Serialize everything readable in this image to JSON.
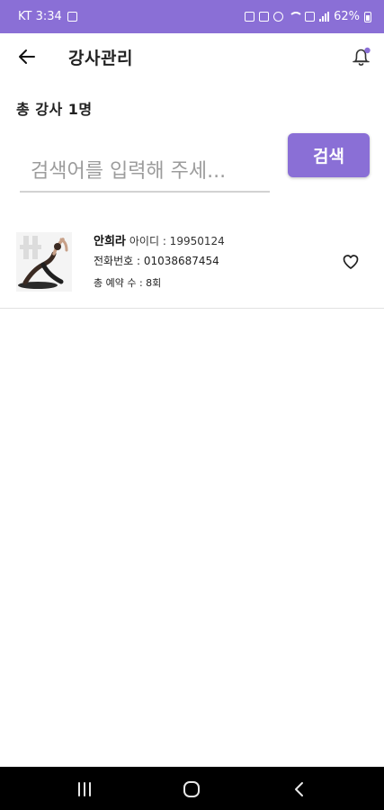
{
  "status_bar": {
    "carrier_time": "KT 3:34",
    "battery": "62%"
  },
  "app_bar": {
    "title": "강사관리"
  },
  "summary": {
    "count_text": "총 강사 1명"
  },
  "search": {
    "placeholder": "검색어를 입력해 주세...",
    "value": "",
    "button_label": "검색"
  },
  "instructors": [
    {
      "name": "안희라",
      "id": "아이디 : 19950124",
      "phone": "전화번호 : 01038687454",
      "reservations": "총 예약 수 : 8회",
      "favorite": false
    }
  ],
  "colors": {
    "accent": "#8a6fd6",
    "status_bar": "#8a6fd6",
    "nav_bar": "#000000"
  },
  "icons": {
    "back": "arrow-left-icon",
    "notification": "bell-icon",
    "favorite": "heart-outline-icon",
    "nav_recents": "recents-icon",
    "nav_home": "home-icon",
    "nav_back": "chevron-left-icon"
  }
}
